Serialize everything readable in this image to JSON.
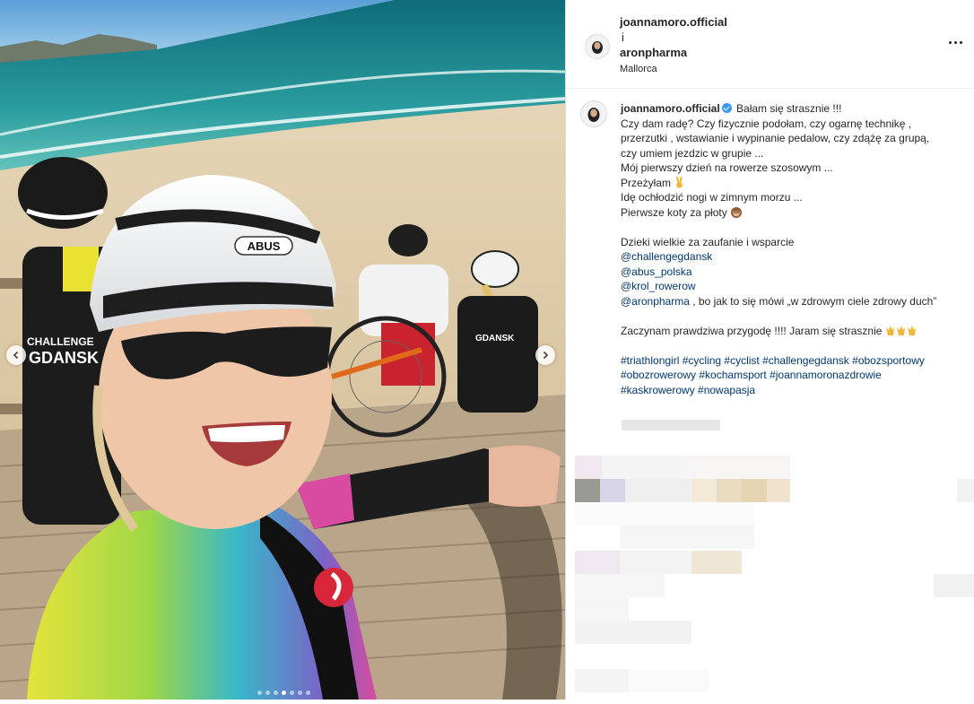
{
  "post": {
    "author": "joannamoro.official",
    "collab_join": "i",
    "collaborator": "aronpharma",
    "location": "Mallorca"
  },
  "photo": {
    "helmet_brand": "ABUS",
    "jersey_text_top": "CHALLENGE",
    "jersey_text_bottom": "GDANSK",
    "carousel_total": 7,
    "carousel_active": 3
  },
  "caption": {
    "author": "joannamoro.official",
    "lines": [
      "Bałam się strasznie !!!",
      "Czy dam radę? Czy fizycznie podołam, czy ogarnę technikę ,",
      "przerzutki , wstawianie i wypinanie pedalow, czy zdążę za grupą,",
      "czy umiem jezdzic w grupie ...",
      "Mój pierwszy dzień na rowerze szosowym ...",
      "Przeżyłam",
      "Idę ochłodzić nogi w zimnym morzu ...",
      "Pierwsze koty za płoty",
      "Dzieki wielkie za zaufanie i wsparcie",
      "bo jak to się mówi „w zdrowym ciele zdrowy duch”",
      "Zaczynam prawdziwa przygodę !!!! Jaram się strasznie"
    ],
    "mentions": [
      "@challengegdansk",
      "@abus_polska",
      "@krol_rowerow",
      "@aronpharma"
    ],
    "hashtags_line1": "#triathlongirl #cycling #cyclist #challengegdansk #obozsportowy",
    "hashtags_line2": "#obozrowerowy #kochamsport #joannamoronazdrowie",
    "hashtags_line3": "#kaskrowerowy #nowapasja"
  },
  "icons": {
    "more": "more-horizontal-icon",
    "prev": "chevron-left-icon",
    "next": "chevron-right-icon",
    "verified": "verified-badge-icon"
  }
}
